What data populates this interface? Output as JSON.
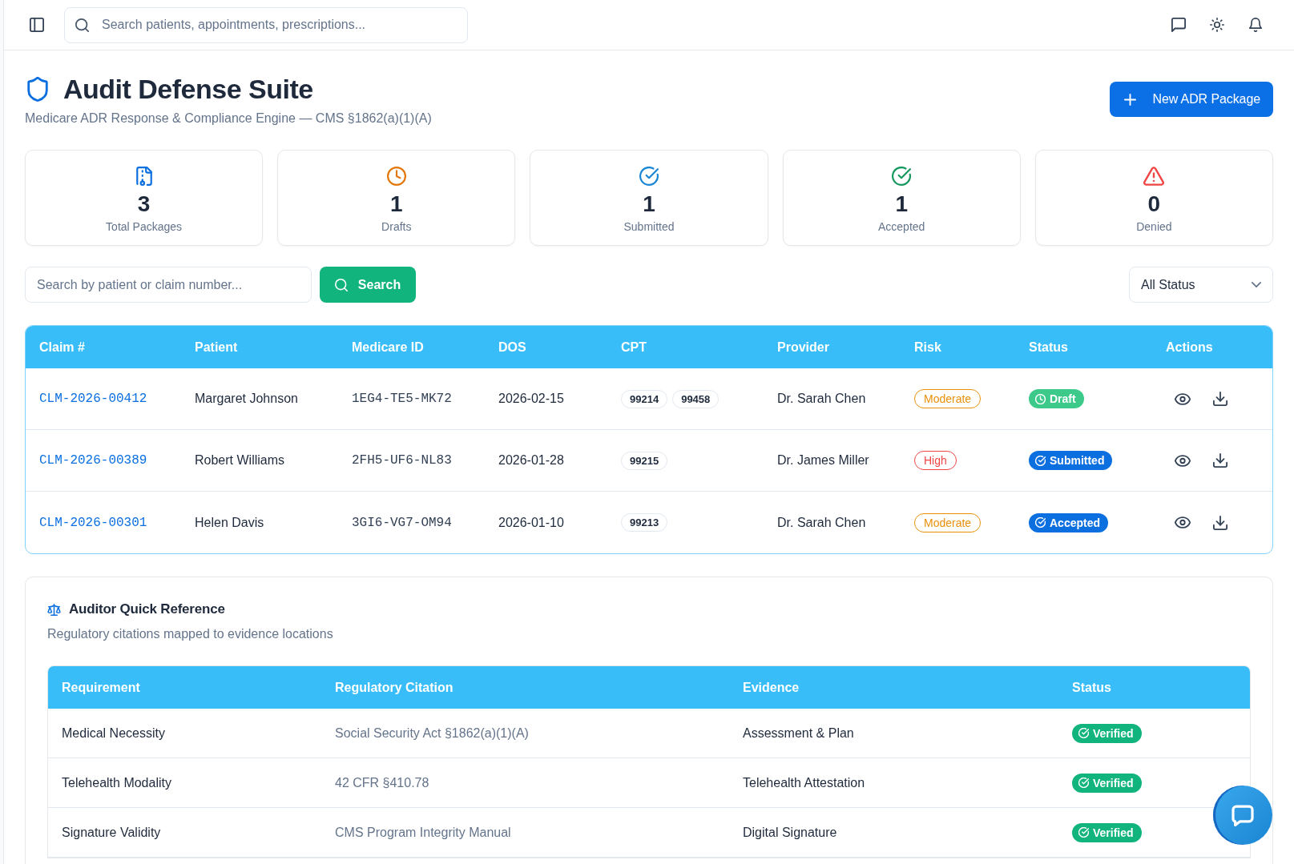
{
  "header": {
    "search": {
      "placeholder": "Search patients, appointments, prescriptions..."
    }
  },
  "page": {
    "title": "Audit Defense Suite",
    "subtitle": "Medicare ADR Response & Compliance Engine — CMS §1862(a)(1)(A)",
    "new_button": "New ADR Package"
  },
  "stats": [
    {
      "kind": "total",
      "value": "3",
      "label": "Total Packages",
      "color": "#0b6fe0"
    },
    {
      "kind": "draft",
      "value": "1",
      "label": "Drafts",
      "color": "#e2780c"
    },
    {
      "kind": "submitted",
      "value": "1",
      "label": "Submitted",
      "color": "#1a86d4"
    },
    {
      "kind": "accepted",
      "value": "1",
      "label": "Accepted",
      "color": "#16985f"
    },
    {
      "kind": "denied",
      "value": "0",
      "label": "Denied",
      "color": "#ef4444"
    }
  ],
  "filters": {
    "search": {
      "placeholder": "Search by patient or claim number..."
    },
    "search_button": "Search",
    "status_select": {
      "value": "All Status"
    }
  },
  "claims_table": {
    "columns": [
      "Claim #",
      "Patient",
      "Medicare ID",
      "DOS",
      "CPT",
      "Provider",
      "Risk",
      "Status",
      "Actions"
    ],
    "rows": [
      {
        "claim": "CLM-2026-00412",
        "patient": "Margaret Johnson",
        "medicare_id": "1EG4-TE5-MK72",
        "dos": "2026-02-15",
        "cpt": [
          "99214",
          "99458"
        ],
        "provider": "Dr. Sarah Chen",
        "risk": {
          "label": "Moderate",
          "color": "#e8900a"
        },
        "status": {
          "label": "Draft",
          "kind": "draft",
          "color": "#3cc98a"
        }
      },
      {
        "claim": "CLM-2026-00389",
        "patient": "Robert Williams",
        "medicare_id": "2FH5-UF6-NL83",
        "dos": "2026-01-28",
        "cpt": [
          "99215"
        ],
        "provider": "Dr. James Miller",
        "risk": {
          "label": "High",
          "color": "#ef4444"
        },
        "status": {
          "label": "Submitted",
          "kind": "submitted",
          "color": "#0b6fe0"
        }
      },
      {
        "claim": "CLM-2026-00301",
        "patient": "Helen Davis",
        "medicare_id": "3GI6-VG7-OM94",
        "dos": "2026-01-10",
        "cpt": [
          "99213"
        ],
        "provider": "Dr. Sarah Chen",
        "risk": {
          "label": "Moderate",
          "color": "#e8900a"
        },
        "status": {
          "label": "Accepted",
          "kind": "accepted",
          "color": "#0b6fe0"
        }
      }
    ]
  },
  "reference": {
    "title": "Auditor Quick Reference",
    "subtitle": "Regulatory citations mapped to evidence locations",
    "columns": [
      "Requirement",
      "Regulatory Citation",
      "Evidence",
      "Status"
    ],
    "rows": [
      {
        "requirement": "Medical Necessity",
        "citation": "Social Security Act §1862(a)(1)(A)",
        "evidence": "Assessment & Plan",
        "status": {
          "label": "Verified",
          "kind": "verified",
          "color": "#12b47e"
        }
      },
      {
        "requirement": "Telehealth Modality",
        "citation": "42 CFR §410.78",
        "evidence": "Telehealth Attestation",
        "status": {
          "label": "Verified",
          "kind": "verified",
          "color": "#12b47e"
        }
      },
      {
        "requirement": "Signature Validity",
        "citation": "CMS Program Integrity Manual",
        "evidence": "Digital Signature",
        "status": {
          "label": "Verified",
          "kind": "verified",
          "color": "#12b47e"
        }
      }
    ]
  }
}
